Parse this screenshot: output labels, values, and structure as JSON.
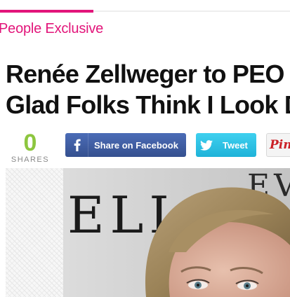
{
  "article": {
    "category": "People Exclusive",
    "headline_line1": "Renée Zellweger to PEO",
    "headline_line2": "Glad Folks Think I Look D"
  },
  "share": {
    "count": "0",
    "count_label": "SHARES",
    "facebook_label": "Share on Facebook",
    "twitter_label": "Tweet",
    "pinterest_label": "Pin"
  },
  "photo": {
    "backdrop_letters": "ELLE",
    "backdrop_letters_right": "EV"
  },
  "icons": {
    "facebook": "facebook-icon",
    "twitter": "twitter-icon"
  },
  "colors": {
    "accent": "#e2157a",
    "share_count": "#8dc63f",
    "facebook": "#3b5998",
    "twitter": "#2cc2e6",
    "pinterest": "#cb2027"
  }
}
